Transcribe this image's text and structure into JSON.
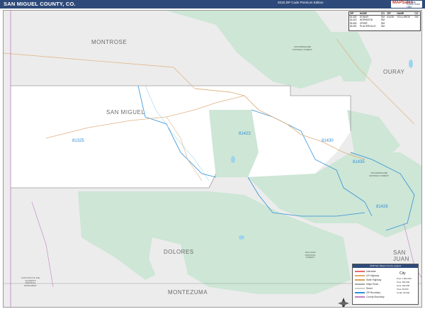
{
  "header": {
    "title": "SAN MIGUEL COUNTY, CO.",
    "edition": "2018 ZIP Code Premium Edition"
  },
  "counties": {
    "montrose": "MONTROSE",
    "san_miguel": "SAN MIGUEL",
    "ouray": "OURAY",
    "dolores": "DOLORES",
    "montezuma": "MONTEZUMA",
    "san_juan": "SAN JUAN"
  },
  "zip_codes": {
    "z81325": "81325",
    "z81423": "81423",
    "z81430": "81430",
    "z81435": "81435",
    "z81426": "81426"
  },
  "zip_table": {
    "header": [
      "ZIP",
      "NAME",
      "CO",
      "ZIP",
      "NAME",
      "CO"
    ],
    "rows": [
      [
        "81325",
        "EGNAR",
        "SM",
        "81435",
        "TELLURIDE",
        "SM"
      ],
      [
        "81423",
        "NORWOOD",
        "SM",
        "",
        "",
        ""
      ],
      [
        "81426",
        "OPHIR",
        "SM",
        "",
        "",
        ""
      ],
      [
        "81430",
        "PLACERVILLE",
        "SM",
        "",
        "",
        ""
      ]
    ]
  },
  "legend": {
    "title": "2018 San Miguel County Legend",
    "city_heading": "City",
    "items": [
      {
        "label": "Interstate",
        "color": "#e36b6b"
      },
      {
        "label": "US Highway",
        "color": "#e3a86b"
      },
      {
        "label": "State Highway",
        "color": "#d9a15a"
      },
      {
        "label": "Major Road",
        "color": "#aaaaaa"
      },
      {
        "label": "Street",
        "color": "#cccccc"
      },
      {
        "label": "ZIP Boundary",
        "color": "#2f8fd6"
      },
      {
        "label": "County Boundary",
        "color": "#c080c0"
      }
    ],
    "city_sizes": [
      "Over 1,000,000",
      "Over 250,000",
      "Over 100,000",
      "Over 25,000",
      "Under 25,000"
    ]
  },
  "forest_labels": {
    "uncompahgre_north": "UNCOMPAHGRE NATIONAL FOREST",
    "uncompahgre_east": "UNCOMPAHGRE NATIONAL FOREST",
    "san_juan": "SAN JUAN NATIONAL FOREST",
    "canyons": "CANYONS OF THE ANCIENTS NATIONAL MONUMENT"
  },
  "colors": {
    "header_bg": "#2e4a7a",
    "forest_green": "#cde6d6",
    "outside_gray": "#ececec",
    "county_white": "#ffffff",
    "zip_line": "#2f8fd6",
    "road": "#e0b080"
  },
  "brand": {
    "name": "MAPSales",
    "tagline": "The Map Source Since 1989"
  }
}
